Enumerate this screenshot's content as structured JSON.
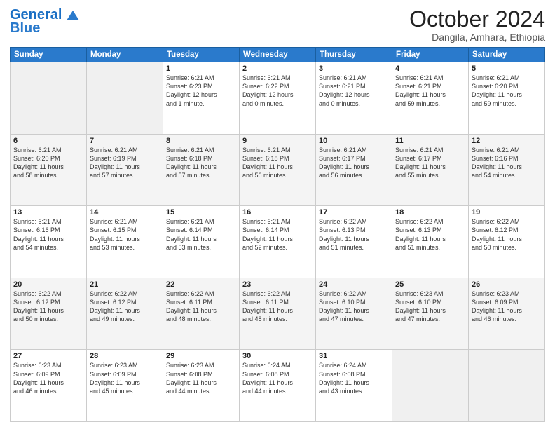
{
  "header": {
    "logo_line1": "General",
    "logo_line2": "Blue",
    "month_title": "October 2024",
    "subtitle": "Dangila, Amhara, Ethiopia"
  },
  "weekdays": [
    "Sunday",
    "Monday",
    "Tuesday",
    "Wednesday",
    "Thursday",
    "Friday",
    "Saturday"
  ],
  "weeks": [
    [
      {
        "day": "",
        "info": ""
      },
      {
        "day": "",
        "info": ""
      },
      {
        "day": "1",
        "info": "Sunrise: 6:21 AM\nSunset: 6:23 PM\nDaylight: 12 hours\nand 1 minute."
      },
      {
        "day": "2",
        "info": "Sunrise: 6:21 AM\nSunset: 6:22 PM\nDaylight: 12 hours\nand 0 minutes."
      },
      {
        "day": "3",
        "info": "Sunrise: 6:21 AM\nSunset: 6:21 PM\nDaylight: 12 hours\nand 0 minutes."
      },
      {
        "day": "4",
        "info": "Sunrise: 6:21 AM\nSunset: 6:21 PM\nDaylight: 11 hours\nand 59 minutes."
      },
      {
        "day": "5",
        "info": "Sunrise: 6:21 AM\nSunset: 6:20 PM\nDaylight: 11 hours\nand 59 minutes."
      }
    ],
    [
      {
        "day": "6",
        "info": "Sunrise: 6:21 AM\nSunset: 6:20 PM\nDaylight: 11 hours\nand 58 minutes."
      },
      {
        "day": "7",
        "info": "Sunrise: 6:21 AM\nSunset: 6:19 PM\nDaylight: 11 hours\nand 57 minutes."
      },
      {
        "day": "8",
        "info": "Sunrise: 6:21 AM\nSunset: 6:18 PM\nDaylight: 11 hours\nand 57 minutes."
      },
      {
        "day": "9",
        "info": "Sunrise: 6:21 AM\nSunset: 6:18 PM\nDaylight: 11 hours\nand 56 minutes."
      },
      {
        "day": "10",
        "info": "Sunrise: 6:21 AM\nSunset: 6:17 PM\nDaylight: 11 hours\nand 56 minutes."
      },
      {
        "day": "11",
        "info": "Sunrise: 6:21 AM\nSunset: 6:17 PM\nDaylight: 11 hours\nand 55 minutes."
      },
      {
        "day": "12",
        "info": "Sunrise: 6:21 AM\nSunset: 6:16 PM\nDaylight: 11 hours\nand 54 minutes."
      }
    ],
    [
      {
        "day": "13",
        "info": "Sunrise: 6:21 AM\nSunset: 6:16 PM\nDaylight: 11 hours\nand 54 minutes."
      },
      {
        "day": "14",
        "info": "Sunrise: 6:21 AM\nSunset: 6:15 PM\nDaylight: 11 hours\nand 53 minutes."
      },
      {
        "day": "15",
        "info": "Sunrise: 6:21 AM\nSunset: 6:14 PM\nDaylight: 11 hours\nand 53 minutes."
      },
      {
        "day": "16",
        "info": "Sunrise: 6:21 AM\nSunset: 6:14 PM\nDaylight: 11 hours\nand 52 minutes."
      },
      {
        "day": "17",
        "info": "Sunrise: 6:22 AM\nSunset: 6:13 PM\nDaylight: 11 hours\nand 51 minutes."
      },
      {
        "day": "18",
        "info": "Sunrise: 6:22 AM\nSunset: 6:13 PM\nDaylight: 11 hours\nand 51 minutes."
      },
      {
        "day": "19",
        "info": "Sunrise: 6:22 AM\nSunset: 6:12 PM\nDaylight: 11 hours\nand 50 minutes."
      }
    ],
    [
      {
        "day": "20",
        "info": "Sunrise: 6:22 AM\nSunset: 6:12 PM\nDaylight: 11 hours\nand 50 minutes."
      },
      {
        "day": "21",
        "info": "Sunrise: 6:22 AM\nSunset: 6:12 PM\nDaylight: 11 hours\nand 49 minutes."
      },
      {
        "day": "22",
        "info": "Sunrise: 6:22 AM\nSunset: 6:11 PM\nDaylight: 11 hours\nand 48 minutes."
      },
      {
        "day": "23",
        "info": "Sunrise: 6:22 AM\nSunset: 6:11 PM\nDaylight: 11 hours\nand 48 minutes."
      },
      {
        "day": "24",
        "info": "Sunrise: 6:22 AM\nSunset: 6:10 PM\nDaylight: 11 hours\nand 47 minutes."
      },
      {
        "day": "25",
        "info": "Sunrise: 6:23 AM\nSunset: 6:10 PM\nDaylight: 11 hours\nand 47 minutes."
      },
      {
        "day": "26",
        "info": "Sunrise: 6:23 AM\nSunset: 6:09 PM\nDaylight: 11 hours\nand 46 minutes."
      }
    ],
    [
      {
        "day": "27",
        "info": "Sunrise: 6:23 AM\nSunset: 6:09 PM\nDaylight: 11 hours\nand 46 minutes."
      },
      {
        "day": "28",
        "info": "Sunrise: 6:23 AM\nSunset: 6:09 PM\nDaylight: 11 hours\nand 45 minutes."
      },
      {
        "day": "29",
        "info": "Sunrise: 6:23 AM\nSunset: 6:08 PM\nDaylight: 11 hours\nand 44 minutes."
      },
      {
        "day": "30",
        "info": "Sunrise: 6:24 AM\nSunset: 6:08 PM\nDaylight: 11 hours\nand 44 minutes."
      },
      {
        "day": "31",
        "info": "Sunrise: 6:24 AM\nSunset: 6:08 PM\nDaylight: 11 hours\nand 43 minutes."
      },
      {
        "day": "",
        "info": ""
      },
      {
        "day": "",
        "info": ""
      }
    ]
  ]
}
